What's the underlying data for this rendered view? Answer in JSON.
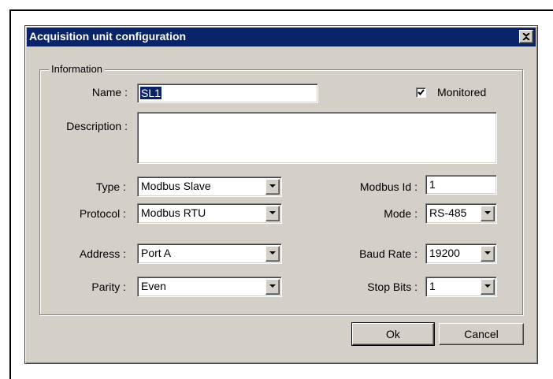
{
  "window": {
    "title": "Acquisition unit configuration",
    "close_glyph": "✕"
  },
  "information": {
    "group_label": "Information",
    "name_label": "Name :",
    "name_value": "SL1",
    "monitored_label": "Monitored",
    "monitored_checked": true,
    "description_label": "Description :",
    "description_value": ""
  },
  "fields": {
    "type_label": "Type :",
    "type_value": "Modbus Slave",
    "protocol_label": "Protocol :",
    "protocol_value": "Modbus RTU",
    "address_label": "Address :",
    "address_value": "Port A",
    "parity_label": "Parity :",
    "parity_value": "Even",
    "modbus_id_label": "Modbus Id :",
    "modbus_id_value": "1",
    "mode_label": "Mode :",
    "mode_value": "RS-485",
    "baud_rate_label": "Baud Rate :",
    "baud_rate_value": "19200",
    "stop_bits_label": "Stop Bits :",
    "stop_bits_value": "1"
  },
  "buttons": {
    "ok_label": "Ok",
    "cancel_label": "Cancel"
  },
  "colors": {
    "titlebar": "#0a246a",
    "dialog_face": "#d4d0c8"
  }
}
